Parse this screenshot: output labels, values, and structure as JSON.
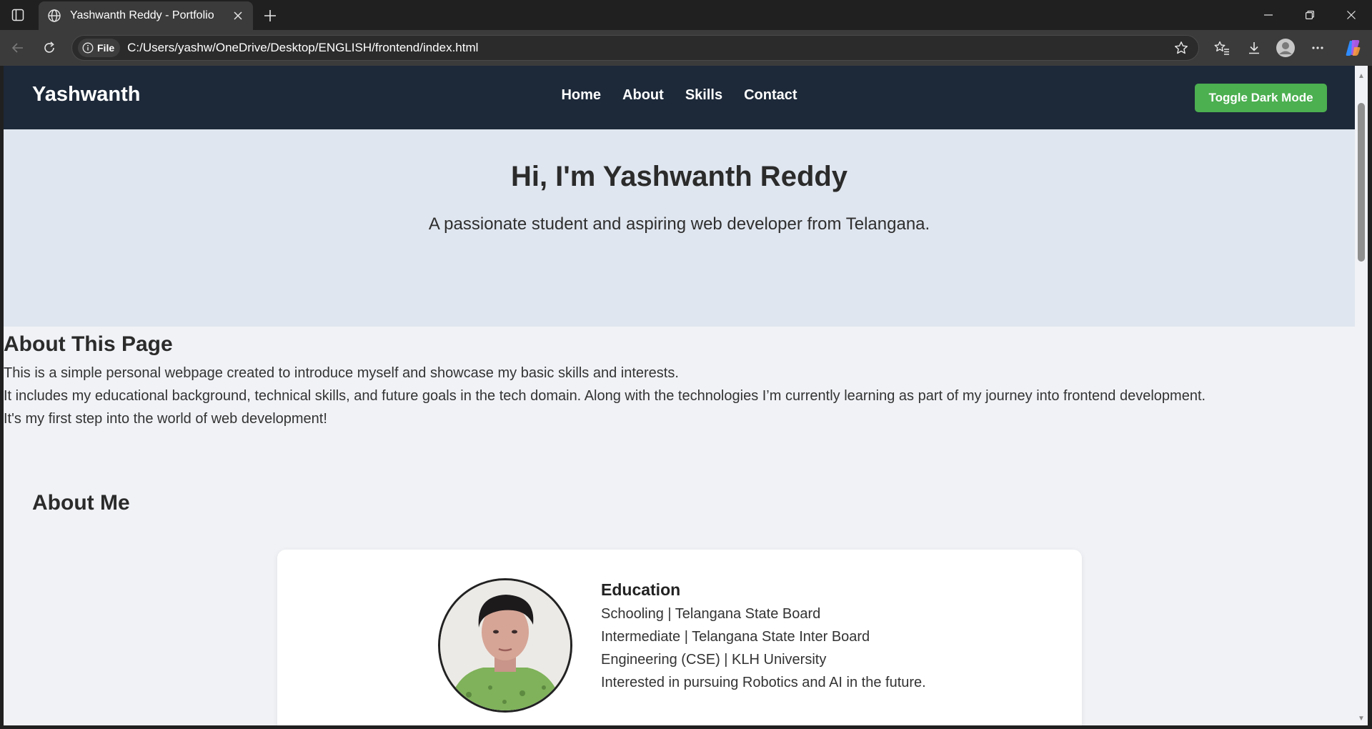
{
  "browser": {
    "tab_title": "Yashwanth Reddy - Portfolio",
    "site_info_label": "File",
    "url": "C:/Users/yashw/OneDrive/Desktop/ENGLISH/frontend/index.html"
  },
  "site": {
    "brand": "Yashwanth",
    "nav": [
      "Home",
      "About",
      "Skills",
      "Contact"
    ],
    "toggle_label": "Toggle Dark Mode"
  },
  "hero": {
    "heading": "Hi, I'm Yashwanth Reddy",
    "subheading": "A passionate student and aspiring web developer from Telangana."
  },
  "about_page": {
    "title": "About This Page",
    "lines": [
      "This is a simple personal webpage created to introduce myself and showcase my basic skills and interests.",
      "It includes my educational background, technical skills, and future goals in the tech domain. Along with the technologies I’m currently learning as part of my journey into frontend development.",
      "It's my first step into the world of web development!"
    ]
  },
  "about_me": {
    "title": "About Me",
    "education_title": "Education",
    "education_lines": [
      "Schooling | Telangana State Board",
      "Intermediate | Telangana State Inter Board",
      "Engineering (CSE) | KLH University",
      "Interested in pursuing Robotics and AI in the future."
    ]
  },
  "colors": {
    "header_bg": "#1d2939",
    "hero_bg": "#e0e6ef",
    "page_bg": "#f0f2f6",
    "toggle_bg": "#4caf50"
  },
  "icons": {
    "tab_actions": "tab-actions-icon",
    "tab_favicon": "globe-icon",
    "tab_close": "close-icon",
    "new_tab": "plus-icon",
    "back": "back-arrow-icon",
    "reload": "reload-icon",
    "site_info": "info-icon",
    "favorite": "star-icon",
    "favorites": "favorites-icon",
    "downloads": "download-icon",
    "profile": "profile-icon",
    "menu": "more-icon",
    "copilot": "copilot-icon"
  }
}
